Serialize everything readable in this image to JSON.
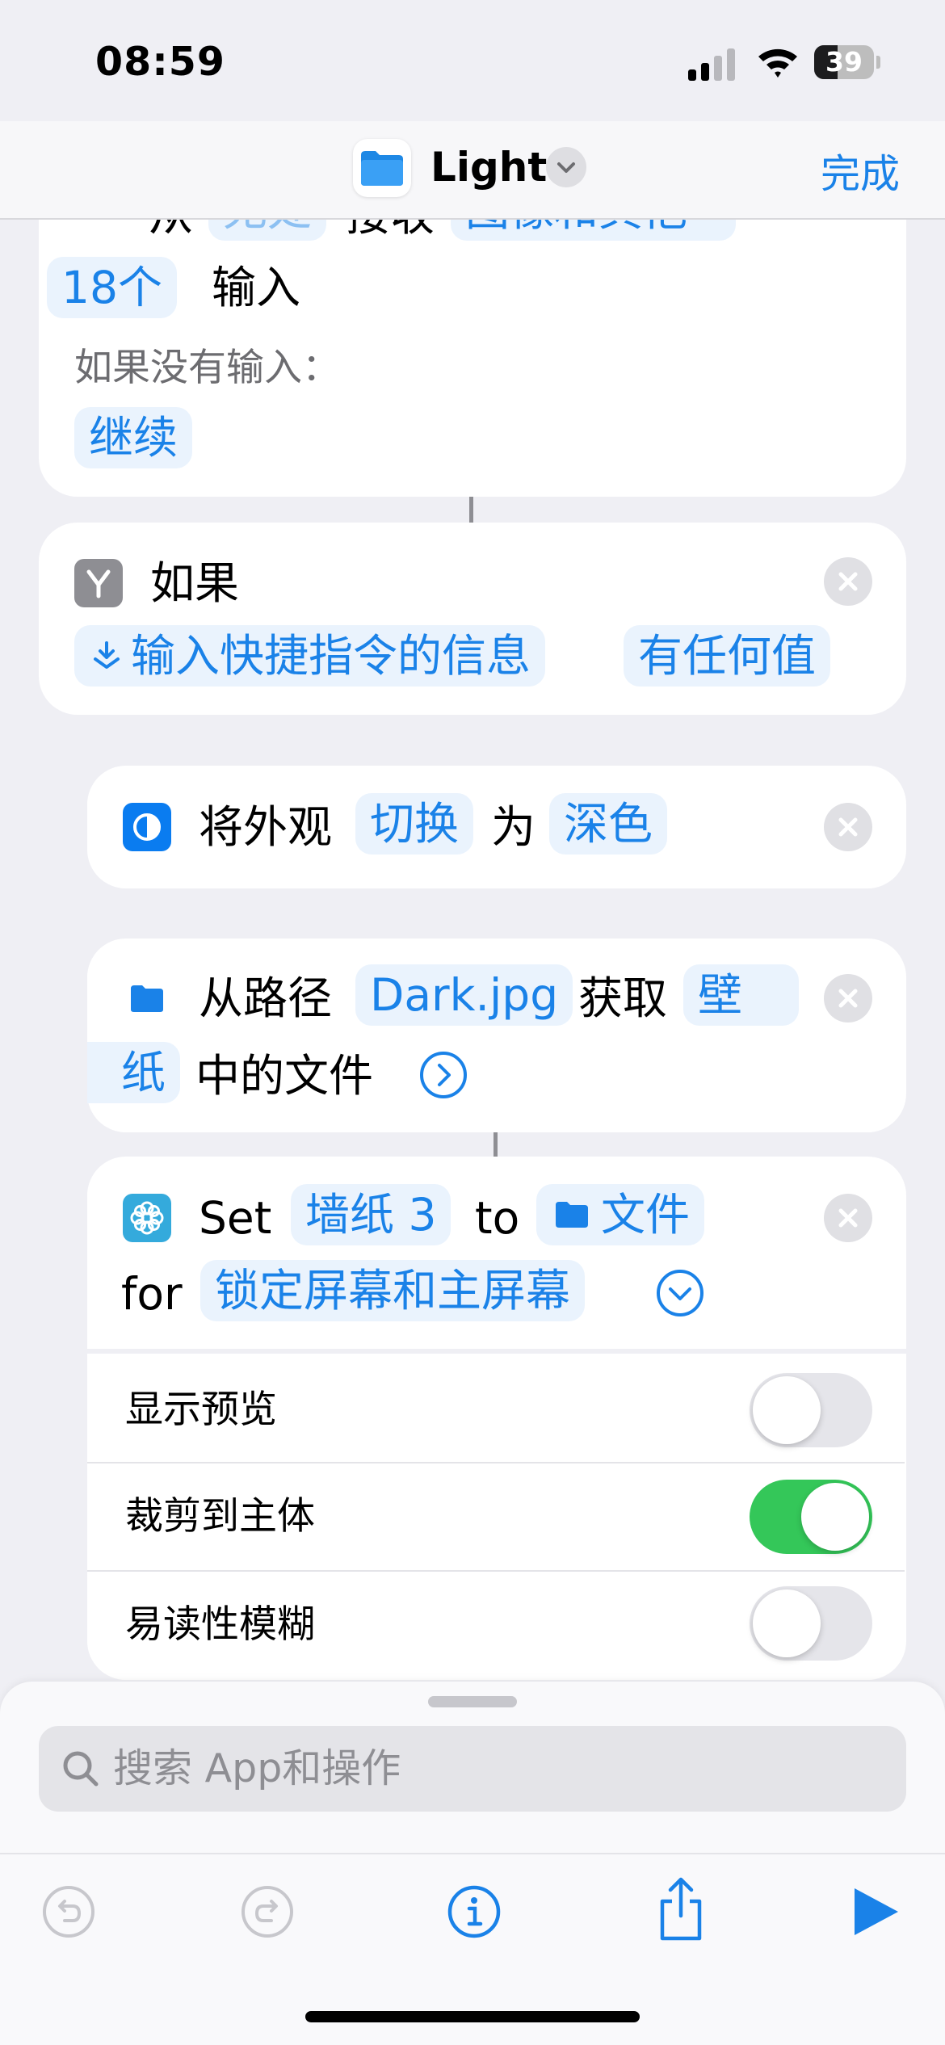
{
  "status_bar": {
    "time": "08:59",
    "battery_level": "39"
  },
  "navbar": {
    "title": "Light",
    "done_label": "完成"
  },
  "card_receive": {
    "partial_top_text_1": "从",
    "partial_top_token_1": "无处",
    "partial_top_text_2": "接收",
    "partial_top_token_2": "图像和其他",
    "count_token": "18个",
    "input_text": "输入",
    "no_input_label": "如果没有输入：",
    "continue_token": "继续"
  },
  "card_if": {
    "label": "如果",
    "condition_token": "输入快捷指令的信息",
    "value_token": "有任何值"
  },
  "card_appearance": {
    "text_1": "将外观",
    "token_1": "切换",
    "text_2": "为",
    "token_2": "深色"
  },
  "card_get_file": {
    "text_1": "从路径",
    "path_token": "Dark.jpg",
    "text_2": "获取",
    "token_line1": "壁",
    "token_line2": "纸",
    "text_3": "中的文件"
  },
  "card_wallpaper": {
    "text_set": "Set",
    "wallpaper_token": "墙纸 3",
    "text_to": "to",
    "file_token": "文件",
    "text_for": "for",
    "screen_token": "锁定屏幕和主屏幕",
    "options": [
      {
        "label": "显示预览",
        "on": false
      },
      {
        "label": "裁剪到主体",
        "on": true
      },
      {
        "label": "易读性模糊",
        "on": false
      }
    ]
  },
  "search": {
    "placeholder": "搜索 App和操作"
  },
  "colors": {
    "accent": "#1a82e8",
    "toggle_on": "#34c759",
    "background": "#efeff4"
  },
  "icons": {
    "toolbar": [
      "undo-icon",
      "redo-icon",
      "info-icon",
      "share-icon",
      "play-icon"
    ]
  }
}
